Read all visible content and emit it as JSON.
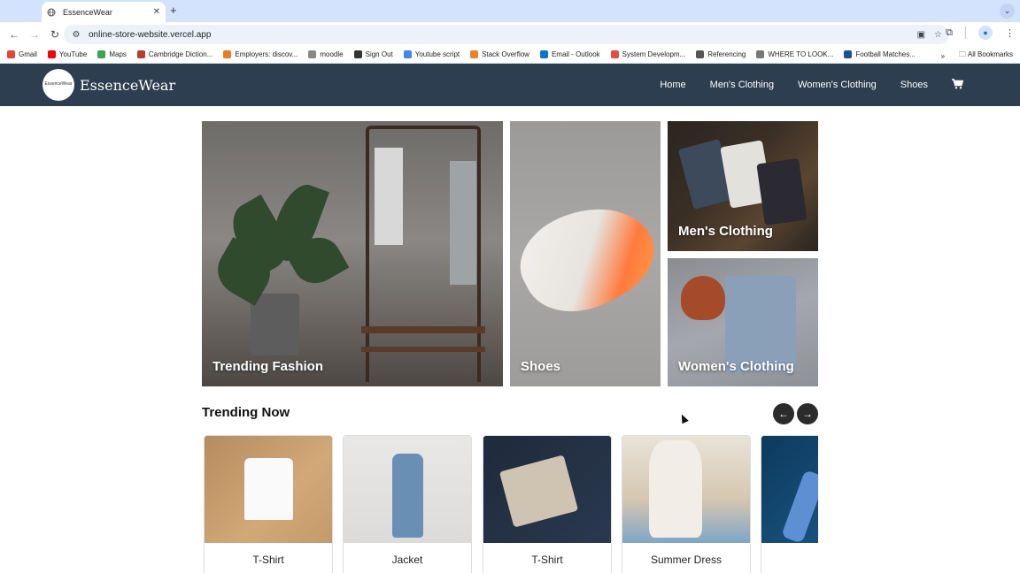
{
  "browser": {
    "tab_title": "EssenceWear",
    "new_tab_symbol": "+",
    "url": "online-store-website.vercel.app",
    "bookmarks": [
      {
        "label": "Gmail",
        "color": "#ea4335"
      },
      {
        "label": "YouTube",
        "color": "#ff0000"
      },
      {
        "label": "Maps",
        "color": "#34a853"
      },
      {
        "label": "Cambridge Diction...",
        "color": "#c0392b"
      },
      {
        "label": "Employers: discov...",
        "color": "#e67e22"
      },
      {
        "label": "moodle",
        "color": "#888888"
      },
      {
        "label": "Sign Out",
        "color": "#333333"
      },
      {
        "label": "Youtube script",
        "color": "#4285f4"
      },
      {
        "label": "Stack Overflow",
        "color": "#f48024"
      },
      {
        "label": "Email - Outlook",
        "color": "#0078d4"
      },
      {
        "label": "System Developm...",
        "color": "#e74c3c"
      },
      {
        "label": "Referencing",
        "color": "#555555"
      },
      {
        "label": "WHERE TO LOOK...",
        "color": "#777777"
      },
      {
        "label": "Football Matches...",
        "color": "#1a4fa0"
      }
    ],
    "all_bookmarks": "All Bookmarks"
  },
  "site": {
    "logo_badge": "EssenceWear",
    "brand": "EssenceWear",
    "nav": [
      "Home",
      "Men's Clothing",
      "Women's Clothing",
      "Shoes"
    ],
    "header_color": "#2c3e50"
  },
  "hero": {
    "trending": "Trending Fashion",
    "shoes": "Shoes",
    "men": "Men's Clothing",
    "women": "Women's Clothing"
  },
  "trending_now": {
    "title": "Trending Now",
    "prev_symbol": "←",
    "next_symbol": "→",
    "products": [
      {
        "name": "T-Shirt"
      },
      {
        "name": "Jacket"
      },
      {
        "name": "T-Shirt"
      },
      {
        "name": "Summer Dress"
      },
      {
        "name": "Je"
      }
    ]
  }
}
